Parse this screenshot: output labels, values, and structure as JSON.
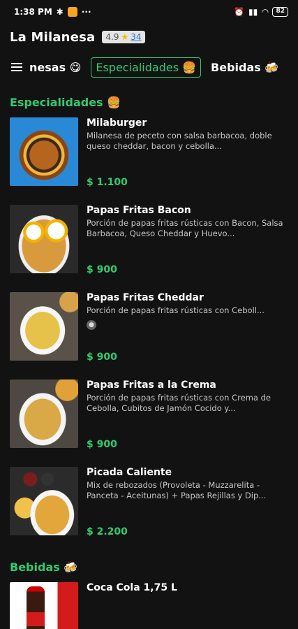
{
  "status": {
    "time": "1:38 PM",
    "battery": "82"
  },
  "header": {
    "title": "La Milanesa",
    "rating": "4.9",
    "rating_count": "34"
  },
  "tabs": [
    {
      "label": "nesas 😋"
    },
    {
      "label": "Especialidades 🍔"
    },
    {
      "label": "Bebidas 🍻"
    }
  ],
  "sections": [
    {
      "title": "Especialidades 🍔",
      "items": [
        {
          "name": "Milaburger",
          "description": "Milanesa de peceto con salsa barbacoa, doble queso cheddar, bacon y cebolla...",
          "price": "$ 1.100"
        },
        {
          "name": "Papas Fritas Bacon",
          "description": "Porción de papas fritas rústicas con Bacon, Salsa Barbacoa, Queso Cheddar y Huevo...",
          "price": "$ 900"
        },
        {
          "name": "Papas Fritas Cheddar",
          "description": "Porción de papas fritas rústicas con Ceboll...",
          "price": "$ 900"
        },
        {
          "name": "Papas Fritas a la Crema",
          "description": "Porción de papas fritas rústicas con Crema de Cebolla, Cubitos de Jamón Cocido y...",
          "price": "$ 900"
        },
        {
          "name": "Picada Caliente",
          "description": "Mix de rebozados (Provoleta - Muzzarelita - Panceta - Aceitunas) + Papas Rejillas y Dip...",
          "price": "$ 2.200"
        }
      ]
    },
    {
      "title": "Bebidas 🍻",
      "items": [
        {
          "name": "Coca Cola 1,75 L"
        }
      ]
    }
  ],
  "colors": {
    "accent": "#2ecc71",
    "background": "#121212"
  }
}
